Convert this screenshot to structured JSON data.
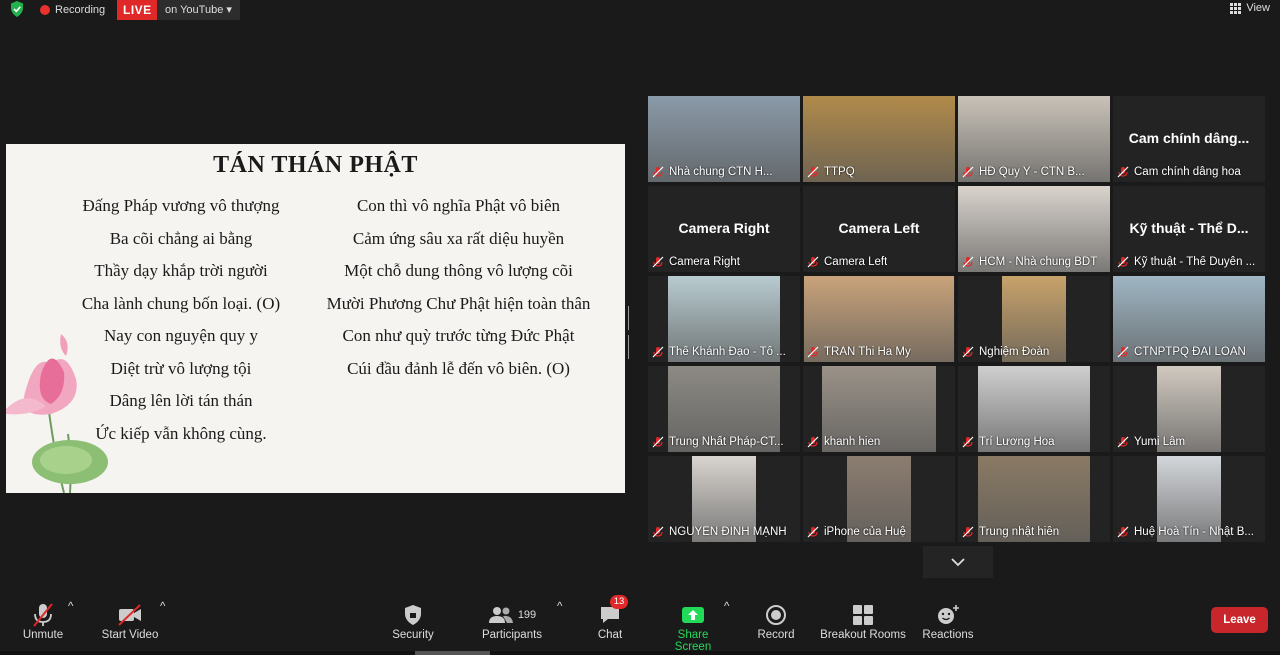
{
  "topbar": {
    "recording": "Recording",
    "live": "LIVE",
    "youtube": "on YouTube ▾",
    "view": "View"
  },
  "share": {
    "title": "TÁN THÁN PHẬT",
    "left_lines": [
      "Đấng Pháp vương vô thượng",
      "Ba cõi chẳng ai bằng",
      "Thầy dạy khắp trời người",
      "Cha lành chung bốn loại. (O)",
      "Nay con nguyện quy y",
      "Diệt trừ vô lượng tội",
      "Dâng lên lời tán thán",
      "Ức kiếp vẫn không cùng."
    ],
    "right_lines": [
      "Con thì vô nghĩa Phật vô biên",
      "Cảm ứng sâu xa rất diệu huyền",
      "Một chỗ dung thông vô lượng cõi",
      "Mười Phương Chư Phật hiện toàn thân",
      "Con như quỳ trước từng Đức Phật",
      "Cúi đầu đảnh lễ đến vô biên. (O)"
    ]
  },
  "participants": [
    {
      "label": "Nhà chung CTN H...",
      "big": "",
      "active": false,
      "bg": "#8a9aa8"
    },
    {
      "label": "TTPQ",
      "big": "",
      "active": true,
      "bg": "#b08a4a"
    },
    {
      "label": "HĐ Quy Y - CTN B...",
      "big": "",
      "active": false,
      "bg": "#c9c2b8"
    },
    {
      "label": "Cam chính dâng hoa",
      "big": "Cam chính dâng...",
      "active": false,
      "bg": ""
    },
    {
      "label": "Camera Right",
      "big": "Camera Right",
      "active": false,
      "bg": ""
    },
    {
      "label": "Camera Left",
      "big": "Camera Left",
      "active": false,
      "bg": ""
    },
    {
      "label": "HCM - Nhà chung BDT",
      "big": "",
      "active": false,
      "bg": "#d9d3cc"
    },
    {
      "label": "Kỹ thuật - Thể Duyên ...",
      "big": "Kỹ thuật - Thể D...",
      "active": false,
      "bg": ""
    },
    {
      "label": "Thể Khánh Đạo - Tổ ...",
      "big": "",
      "active": false,
      "bg": "#b8cbd0"
    },
    {
      "label": "TRAN Thi Ha My",
      "big": "",
      "active": false,
      "bg": "#c9a37a"
    },
    {
      "label": "Nghiệm Đoàn",
      "big": "",
      "active": false,
      "bg": "#c7a26a"
    },
    {
      "label": "CTNPTPQ ĐÀI LOAN",
      "big": "",
      "active": false,
      "bg": "#9fb6c4"
    },
    {
      "label": "Trung Nhất Pháp-CT...",
      "big": "",
      "active": false,
      "bg": "#8d8a84"
    },
    {
      "label": "khanh hien",
      "big": "",
      "active": false,
      "bg": "#9a9288"
    },
    {
      "label": "Trí Lương Hoa",
      "big": "",
      "active": false,
      "bg": "#cfcfcf"
    },
    {
      "label": "Yumi Lâm",
      "big": "",
      "active": false,
      "bg": "#d0c9c0"
    },
    {
      "label": "NGUYỄN ĐÌNH MẠNH",
      "big": "",
      "active": false,
      "bg": "#d8d4cf"
    },
    {
      "label": "iPhone của Huệ",
      "big": "",
      "active": false,
      "bg": "#8c7d70"
    },
    {
      "label": "Trung nhật hiền",
      "big": "",
      "active": false,
      "bg": "#8a7a64"
    },
    {
      "label": "Huệ Hoà Tín - Nhật B...",
      "big": "",
      "active": false,
      "bg": "#d3d6da"
    }
  ],
  "toolbar": {
    "unmute": "Unmute",
    "start_video": "Start Video",
    "security": "Security",
    "participants": "Participants",
    "participants_count": "199",
    "chat": "Chat",
    "chat_badge": "13",
    "share_screen": "Share Screen",
    "record": "Record",
    "breakout": "Breakout Rooms",
    "reactions": "Reactions",
    "leave": "Leave"
  },
  "colors": {
    "active_speaker": "#c8f07a",
    "share_green": "#23d959",
    "leave_red": "#c8262b",
    "muted_red": "#e02828"
  }
}
